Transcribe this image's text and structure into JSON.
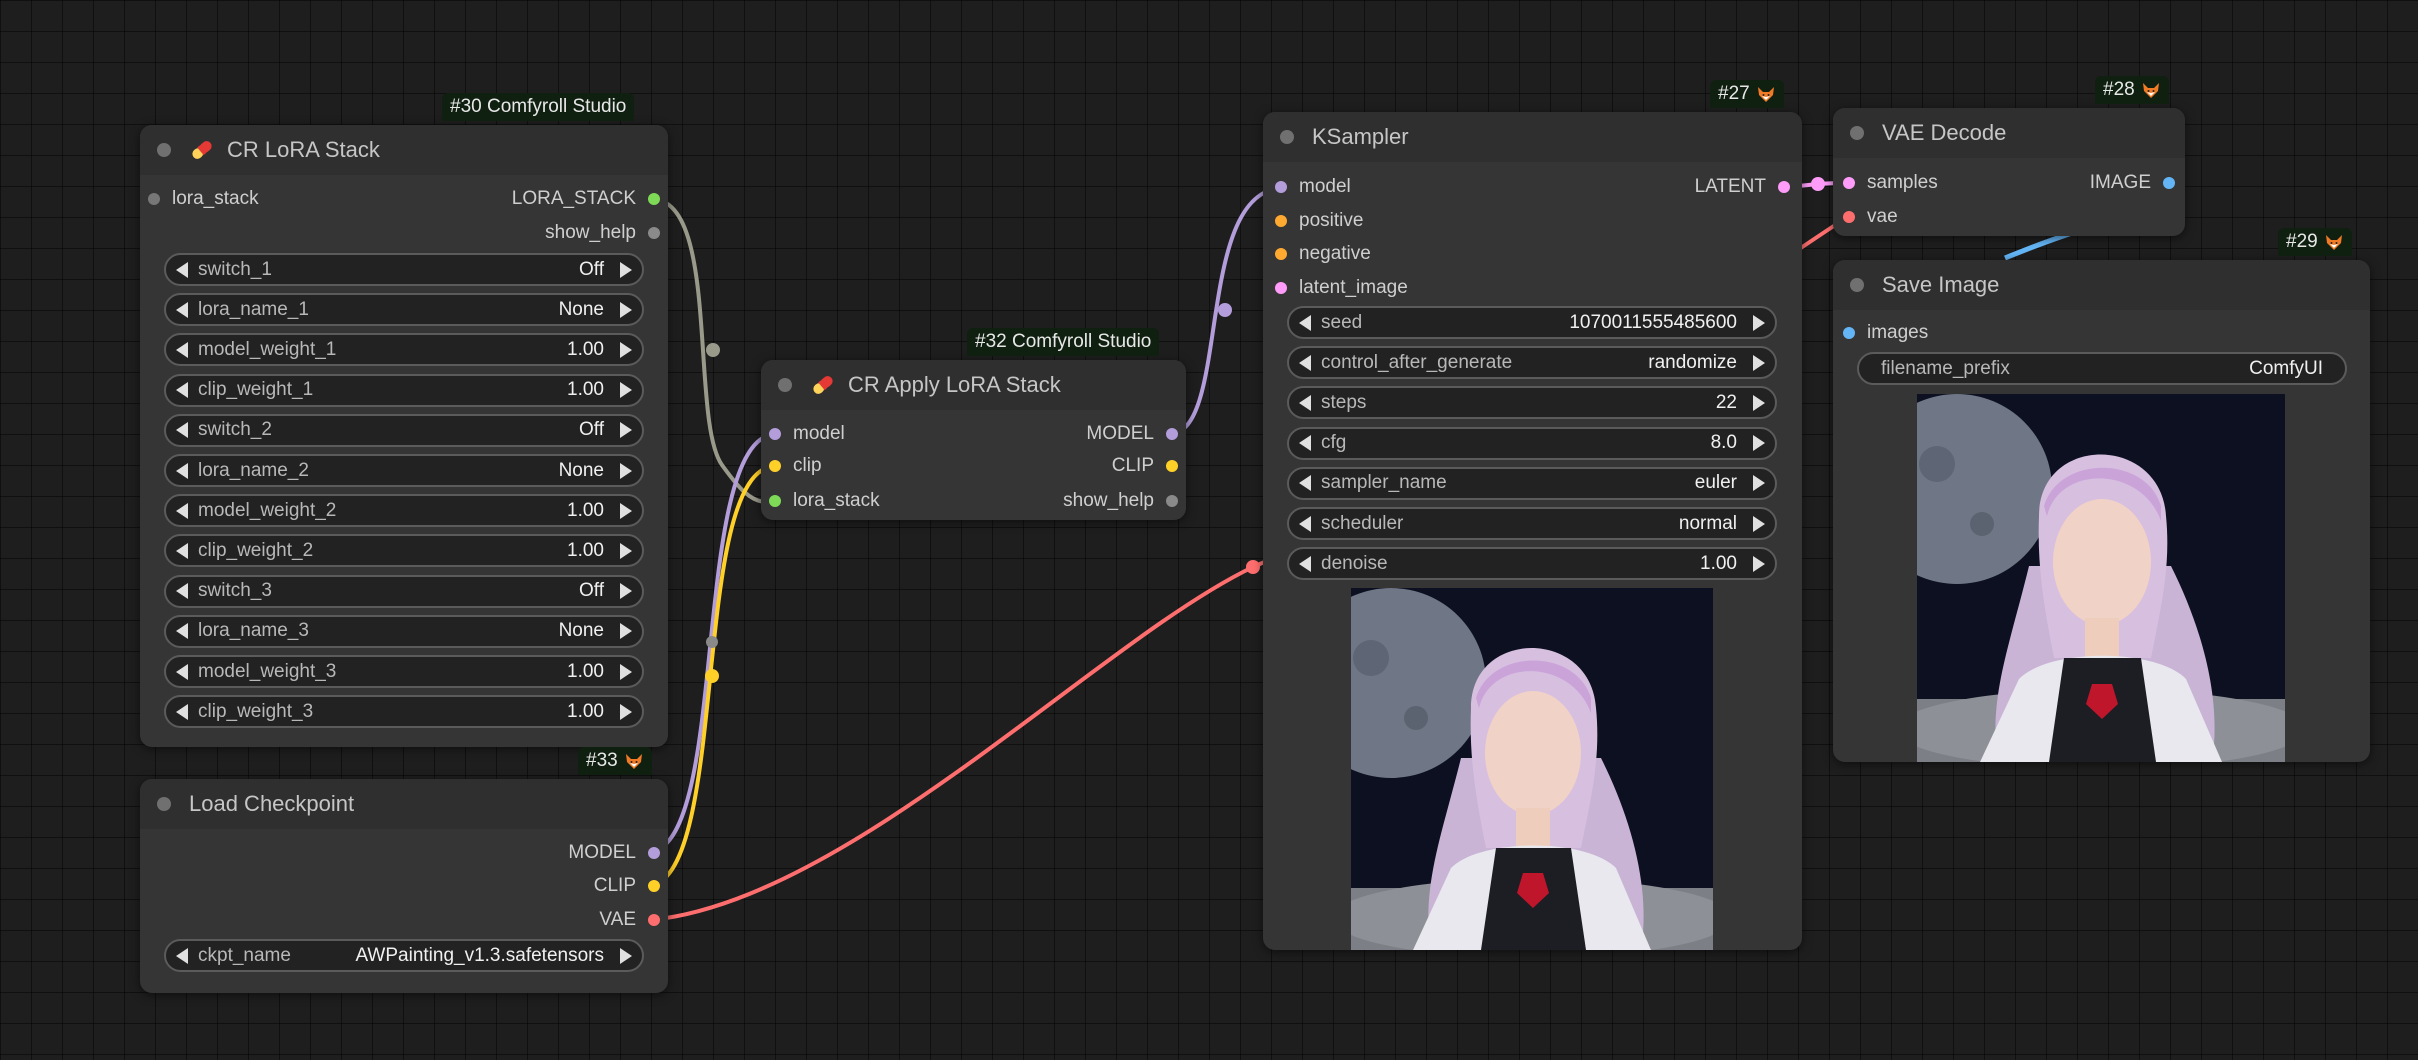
{
  "colors": {
    "model": "#b39ddb",
    "clip": "#ffd028",
    "vae": "#ff6e6e",
    "latent": "#ff9cf9",
    "image": "#64b5f6",
    "lora_stack": "#7ed957",
    "show_help": "#8a8a8a",
    "conditioning": "#ffa931"
  },
  "nodes": {
    "lora_stack": {
      "badge": "#30 Comfyroll Studio",
      "title": "CR LoRA Stack",
      "icon": "pill-icon",
      "inputs": [
        "lora_stack"
      ],
      "outputs": [
        "LORA_STACK",
        "show_help"
      ],
      "widgets": [
        {
          "name": "switch_1",
          "value": "Off"
        },
        {
          "name": "lora_name_1",
          "value": "None"
        },
        {
          "name": "model_weight_1",
          "value": "1.00"
        },
        {
          "name": "clip_weight_1",
          "value": "1.00"
        },
        {
          "name": "switch_2",
          "value": "Off"
        },
        {
          "name": "lora_name_2",
          "value": "None"
        },
        {
          "name": "model_weight_2",
          "value": "1.00"
        },
        {
          "name": "clip_weight_2",
          "value": "1.00"
        },
        {
          "name": "switch_3",
          "value": "Off"
        },
        {
          "name": "lora_name_3",
          "value": "None"
        },
        {
          "name": "model_weight_3",
          "value": "1.00"
        },
        {
          "name": "clip_weight_3",
          "value": "1.00"
        }
      ]
    },
    "apply_lora": {
      "badge": "#32 Comfyroll Studio",
      "title": "CR Apply LoRA Stack",
      "icon": "pill-icon",
      "inputs": [
        "model",
        "clip",
        "lora_stack"
      ],
      "outputs": [
        "MODEL",
        "CLIP",
        "show_help"
      ]
    },
    "checkpoint": {
      "badge": "#33",
      "badge_icon": "fox-icon",
      "title": "Load Checkpoint",
      "outputs": [
        "MODEL",
        "CLIP",
        "VAE"
      ],
      "widgets": [
        {
          "name": "ckpt_name",
          "value": "AWPainting_v1.3.safetensors"
        }
      ]
    },
    "ksampler": {
      "badge": "#27",
      "badge_icon": "fox-icon",
      "title": "KSampler",
      "inputs": [
        "model",
        "positive",
        "negative",
        "latent_image"
      ],
      "outputs": [
        "LATENT"
      ],
      "widgets": [
        {
          "name": "seed",
          "value": "1070011555485600"
        },
        {
          "name": "control_after_generate",
          "value": "randomize"
        },
        {
          "name": "steps",
          "value": "22"
        },
        {
          "name": "cfg",
          "value": "8.0"
        },
        {
          "name": "sampler_name",
          "value": "euler"
        },
        {
          "name": "scheduler",
          "value": "normal"
        },
        {
          "name": "denoise",
          "value": "1.00"
        }
      ]
    },
    "vae_decode": {
      "badge": "#28",
      "badge_icon": "fox-icon",
      "title": "VAE Decode",
      "inputs": [
        "samples",
        "vae"
      ],
      "outputs": [
        "IMAGE"
      ]
    },
    "save_image": {
      "badge": "#29",
      "badge_icon": "fox-icon",
      "title": "Save Image",
      "inputs": [
        "images"
      ],
      "widgets": [
        {
          "name": "filename_prefix",
          "value": "ComfyUI"
        }
      ]
    }
  }
}
